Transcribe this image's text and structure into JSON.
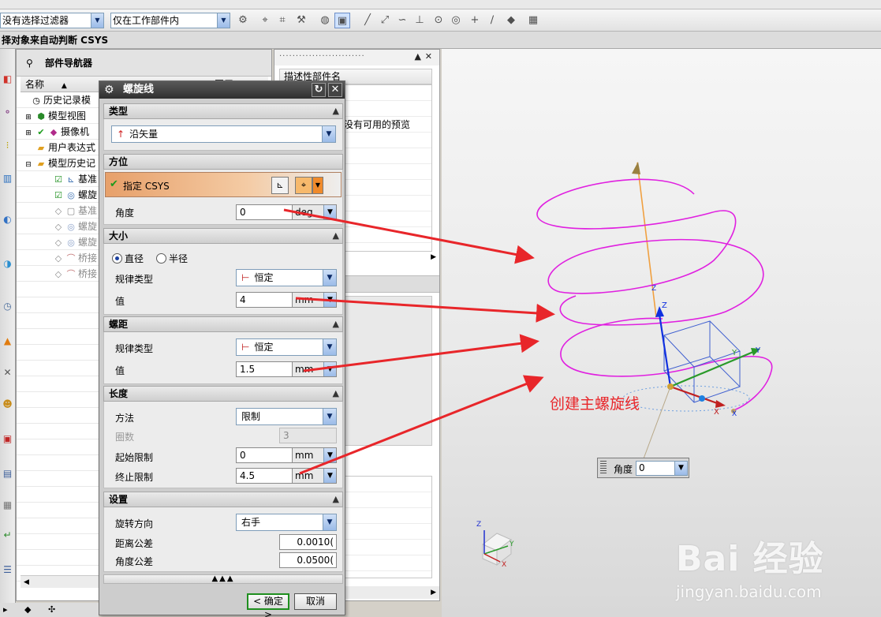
{
  "toolbar": {
    "filter_value": "没有选择过滤器",
    "scope_value": "仅在工作部件内"
  },
  "prompt": "择对象来自动判断 CSYS",
  "part_navigator": {
    "title": "部件导航器",
    "column_name": "名称",
    "column_sort_icon": "sort-up-icon",
    "column_layer": "图层",
    "tree": [
      {
        "label": "历史记录模",
        "state": "normal"
      },
      {
        "label": "模型视图",
        "state": "normal"
      },
      {
        "label": "摄像机",
        "state": "normal"
      },
      {
        "label": "用户表达式",
        "state": "normal"
      },
      {
        "label": "模型历史记",
        "state": "normal"
      },
      {
        "label": "基准",
        "state": "normal"
      },
      {
        "label": "螺旋",
        "state": "normal"
      },
      {
        "label": "基准",
        "state": "suppressed"
      },
      {
        "label": "螺旋",
        "state": "suppressed"
      },
      {
        "label": "螺旋",
        "state": "suppressed"
      },
      {
        "label": "桥接",
        "state": "suppressed"
      },
      {
        "label": "桥接",
        "state": "suppressed"
      }
    ]
  },
  "side_panel": {
    "header": "描述性部件名",
    "preview_text": "没有可用的预览"
  },
  "dialog": {
    "title": "螺旋线",
    "sections": {
      "type": "类型",
      "orientation": "方位",
      "size": "大小",
      "pitch": "螺距",
      "length": "长度",
      "settings": "设置"
    },
    "type_value": "沿矢量",
    "csys_label": "指定 CSYS",
    "angle_label": "角度",
    "angle_value": "0",
    "angle_unit": "deg",
    "size": {
      "diameter": "直径",
      "radius": "半径",
      "selected": "diameter",
      "law_label": "规律类型",
      "law_value": "恒定",
      "value_label": "值",
      "value": "4",
      "unit": "mm"
    },
    "pitch": {
      "law_label": "规律类型",
      "law_value": "恒定",
      "value_label": "值",
      "value": "1.5",
      "unit": "mm"
    },
    "length": {
      "method_label": "方法",
      "method_value": "限制",
      "turns_label": "圈数",
      "turns_value": "3",
      "start_label": "起始限制",
      "start_value": "0",
      "start_unit": "mm",
      "end_label": "终止限制",
      "end_value": "4.5",
      "end_unit": "mm"
    },
    "settings": {
      "direction_label": "旋转方向",
      "direction_value": "右手",
      "dist_tol_label": "距离公差",
      "dist_tol_value": "0.0010(",
      "angle_tol_label": "角度公差",
      "angle_tol_value": "0.0500("
    },
    "ok_label": "< 确定 >",
    "cancel_label": "取消"
  },
  "graphics": {
    "annotation": "创建主螺旋线",
    "angle_widget_label": "角度",
    "angle_widget_value": "0",
    "axis_labels": {
      "z": "Z",
      "y": "Y",
      "x": "X"
    },
    "helix_color": "#e020e0",
    "arrow_color": "#e8262a",
    "watermark_logo": "Bai 经验",
    "watermark_url": "jingyan.baidu.com"
  }
}
